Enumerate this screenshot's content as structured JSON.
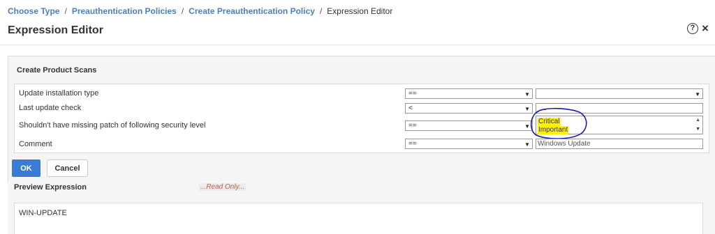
{
  "breadcrumb": {
    "items": [
      "Choose Type",
      "Preauthentication Policies",
      "Create Preauthentication Policy"
    ],
    "separator": "/",
    "current": "Expression Editor"
  },
  "header": {
    "title": "Expression Editor",
    "help_icon": "?",
    "close_icon": "×"
  },
  "panel": {
    "title": "Create Product Scans",
    "rows": [
      {
        "label": "Update installation type",
        "operator": "==",
        "value": "",
        "value_kind": "select"
      },
      {
        "label": "Last update check",
        "operator": "<",
        "value": "",
        "value_kind": "text"
      },
      {
        "label": "Shouldn't have missing patch of following security level",
        "operator": "==",
        "value_kind": "listbox",
        "options": [
          "Critical",
          "Important"
        ]
      },
      {
        "label": "Comment",
        "operator": "==",
        "value": "Windows Update",
        "value_kind": "text"
      }
    ]
  },
  "buttons": {
    "ok": "OK",
    "cancel": "Cancel"
  },
  "preview": {
    "label": "Preview Expression",
    "readonly_note": "...Read Only...",
    "expression": "WIN-UPDATE"
  },
  "colors": {
    "link": "#4a7fbd",
    "primary_button": "#3a7bd5",
    "highlight": "#fff200",
    "annotation": "#1a1aa8"
  },
  "icons": [
    "help-circle-icon",
    "close-icon",
    "dropdown-arrow-icon",
    "scroll-up-icon",
    "scroll-down-icon"
  ]
}
